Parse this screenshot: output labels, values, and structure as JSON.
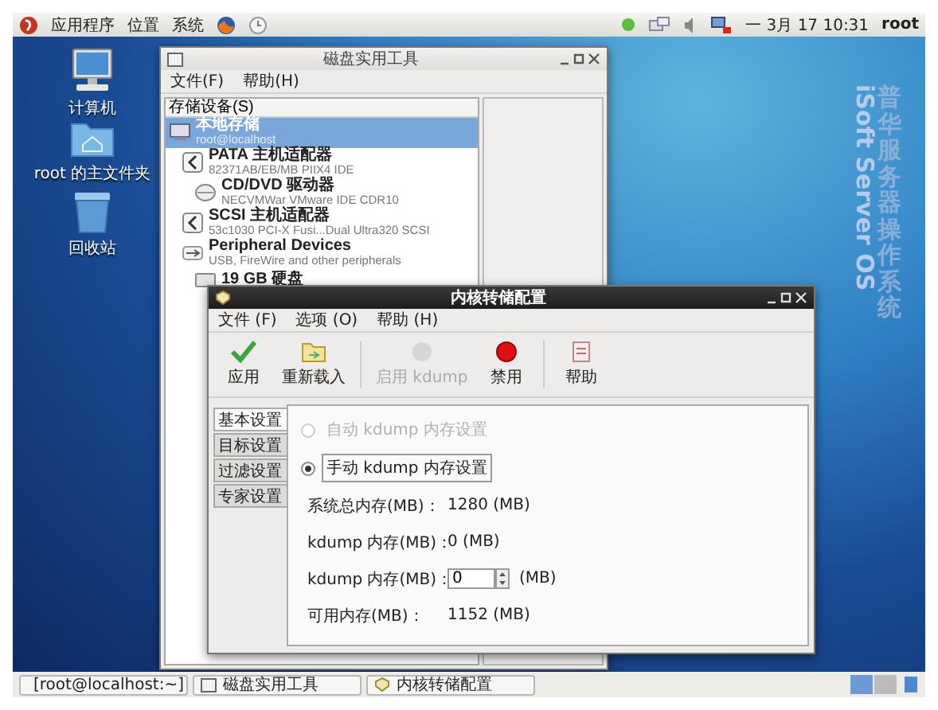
{
  "top_panel": {
    "menus": [
      "应用程序",
      "位置",
      "系统"
    ],
    "clock": "一 3月 17 10:31",
    "user": "root"
  },
  "desktop_icons": [
    {
      "label": "计算机",
      "kind": "computer"
    },
    {
      "label": "root 的主文件夹",
      "kind": "folder"
    },
    {
      "label": "回收站",
      "kind": "trash"
    }
  ],
  "wallpaper": {
    "title": "普华服务器操作系统",
    "subtitle": "iSoft Server OS"
  },
  "disk_window": {
    "title": "磁盘实用工具",
    "menu": [
      "文件(F)",
      "帮助(H)"
    ],
    "pane_header": "存储设备(S)",
    "devices": [
      {
        "name": "本地存储",
        "detail": "root@localhost",
        "kind": "computer",
        "selected": true,
        "children": [
          {
            "name": "PATA 主机适配器",
            "detail": "82371AB/EB/MB PIIX4 IDE",
            "kind": "adapter",
            "selected": false,
            "children": [
              {
                "name": "CD/DVD 驱动器",
                "detail": "NECVMWar VMware IDE CDR10",
                "kind": "optical",
                "selected": false
              }
            ]
          },
          {
            "name": "SCSI 主机适配器",
            "detail": "53c1030 PCI-X Fusi...Dual Ultra320 SCSI",
            "kind": "adapter",
            "selected": false
          },
          {
            "name": "Peripheral Devices",
            "detail": "USB, FireWire and other peripherals",
            "kind": "usb",
            "selected": false,
            "children": [
              {
                "name": "19 GB 硬盘",
                "kind": "disk",
                "selected": false
              }
            ]
          }
        ]
      }
    ]
  },
  "kdump_window": {
    "title": "内核转储配置",
    "menu": [
      "文件 (F)",
      "选项 (O)",
      "帮助 (H)"
    ],
    "toolbar": [
      {
        "label": "应用",
        "kind": "apply",
        "disabled": false
      },
      {
        "label": "重新载入",
        "kind": "reload",
        "disabled": false
      },
      {
        "label": "启用 kdump",
        "kind": "enable",
        "disabled": true
      },
      {
        "label": "禁用",
        "kind": "disable",
        "disabled": false
      },
      {
        "label": "帮助",
        "kind": "help",
        "disabled": false
      }
    ],
    "tabs": [
      {
        "label": "基本设置",
        "selected": true
      },
      {
        "label": "目标设置",
        "selected": false
      },
      {
        "label": "过滤设置",
        "selected": false
      },
      {
        "label": "专家设置",
        "selected": false
      }
    ],
    "radios": [
      {
        "label": "自动 kdump 内存设置",
        "selected": false,
        "disabled": true
      },
      {
        "label": "手动 kdump 内存设置",
        "selected": true,
        "disabled": false
      }
    ],
    "rows": [
      {
        "kind": "text",
        "label": "系统总内存(MB)：",
        "value": "1280 (MB)"
      },
      {
        "kind": "text",
        "label": "kdump 内存(MB)：",
        "value": "0 (MB)"
      },
      {
        "kind": "spin",
        "label": "kdump 内存(MB)：",
        "value": "0",
        "unit": "(MB)"
      },
      {
        "kind": "text",
        "label": "可用内存(MB)：",
        "value": "1152 (MB)"
      }
    ]
  },
  "taskbar": [
    {
      "label": "[root@localhost:~]",
      "kind": "terminal"
    },
    {
      "label": "磁盘实用工具",
      "kind": "disk"
    },
    {
      "label": "内核转储配置",
      "kind": "kdump"
    }
  ]
}
